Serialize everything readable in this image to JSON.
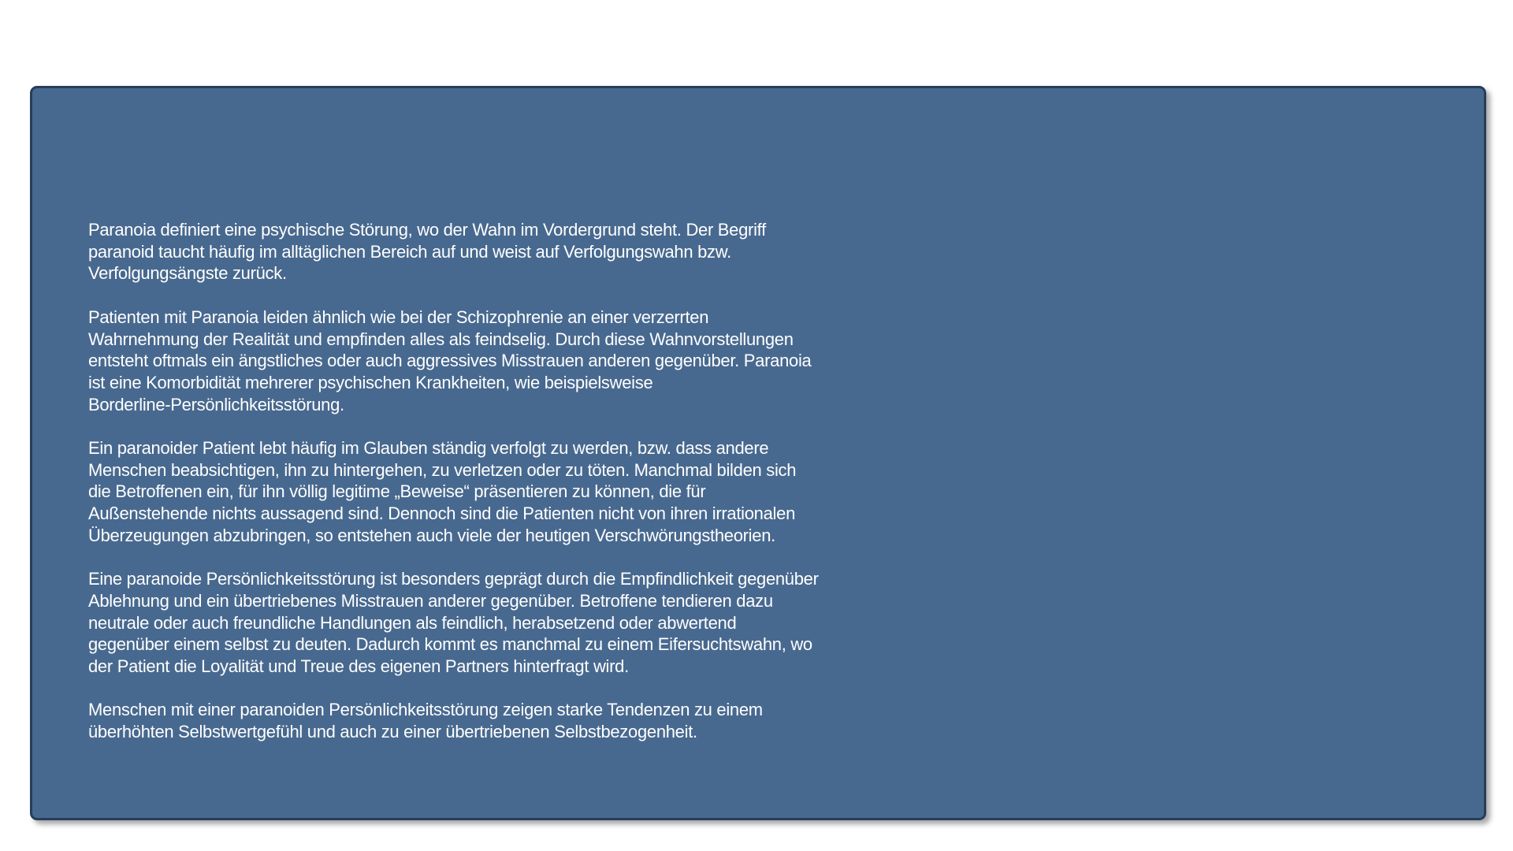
{
  "panel": {
    "background": "#48698f",
    "border": "#263d5c",
    "text_color": "#ffffff"
  },
  "paragraphs": [
    "Paranoia definiert eine psychische Störung, wo der Wahn im Vordergrund steht. Der Begriff\nparanoid taucht häufig im alltäglichen Bereich auf und weist auf Verfolgungswahn bzw.\nVerfolgungsängste zurück.",
    "Patienten mit Paranoia leiden ähnlich wie bei der Schizophrenie an einer verzerrten\nWahrnehmung der Realität und empfinden alles als feindselig. Durch diese Wahnvorstellungen\nentsteht oftmals ein ängstliches oder auch aggressives Misstrauen anderen gegenüber. Paranoia\nist eine Komorbidität mehrerer psychischen Krankheiten, wie beispielsweise\nBorderline-Persönlichkeitsstörung.",
    "Ein paranoider Patient lebt häufig im Glauben ständig verfolgt zu werden, bzw. dass andere\nMenschen beabsichtigen, ihn zu hintergehen, zu verletzen oder zu töten. Manchmal bilden sich\ndie Betroffenen ein, für ihn völlig legitime „Beweise“ präsentieren zu können, die für\nAußenstehende nichts aussagend sind. Dennoch sind die Patienten nicht von ihren irrationalen\nÜberzeugungen abzubringen, so entstehen auch viele der heutigen Verschwörungstheorien.",
    "Eine paranoide Persönlichkeitsstörung ist besonders geprägt durch die Empfindlichkeit gegenüber\nAblehnung und ein übertriebenes Misstrauen anderer gegenüber. Betroffene tendieren dazu\nneutrale oder auch freundliche Handlungen als feindlich, herabsetzend oder abwertend\ngegenüber einem selbst zu deuten. Dadurch kommt es manchmal zu einem Eifersuchtswahn, wo\nder Patient die Loyalität und Treue des eigenen Partners hinterfragt wird.",
    "Menschen mit einer paranoiden Persönlichkeitsstörung zeigen starke Tendenzen zu einem\nüberhöhten Selbstwertgefühl und auch zu einer übertriebenen Selbstbezogenheit."
  ]
}
